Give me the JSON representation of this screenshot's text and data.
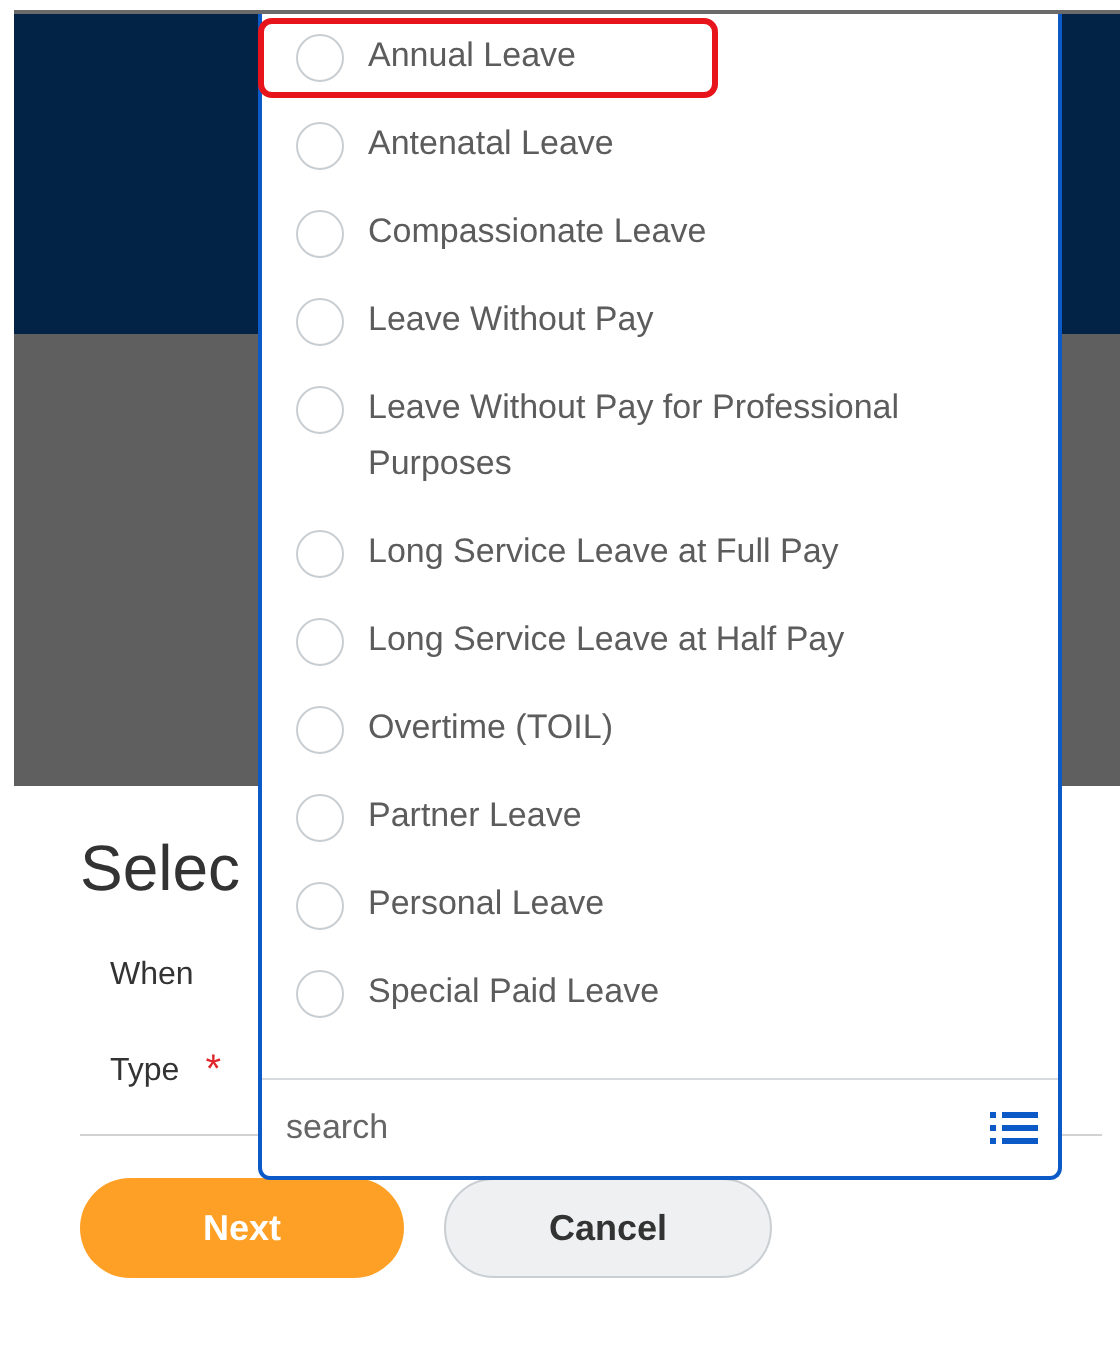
{
  "page": {
    "heading": "Selec"
  },
  "form": {
    "fields": [
      {
        "label": "When"
      },
      {
        "label": "Type",
        "required_mark": "*"
      }
    ]
  },
  "dropdown": {
    "options": [
      {
        "label": "Annual Leave",
        "selected": false,
        "highlighted": true
      },
      {
        "label": "Antenatal Leave",
        "selected": false,
        "highlighted": false
      },
      {
        "label": "Compassionate Leave",
        "selected": false,
        "highlighted": false
      },
      {
        "label": "Leave Without Pay",
        "selected": false,
        "highlighted": false
      },
      {
        "label": "Leave Without Pay for Professional Purposes",
        "selected": false,
        "highlighted": false
      },
      {
        "label": "Long Service Leave at Full Pay",
        "selected": false,
        "highlighted": false
      },
      {
        "label": "Long Service Leave at Half Pay",
        "selected": false,
        "highlighted": false
      },
      {
        "label": "Overtime (TOIL)",
        "selected": false,
        "highlighted": false
      },
      {
        "label": "Partner Leave",
        "selected": false,
        "highlighted": false
      },
      {
        "label": "Personal Leave",
        "selected": false,
        "highlighted": false
      },
      {
        "label": "Special Paid Leave",
        "selected": false,
        "highlighted": false
      }
    ],
    "search": {
      "placeholder": "search"
    }
  },
  "buttons": [
    {
      "label": "Next",
      "kind": "primary"
    },
    {
      "label": "Cancel",
      "kind": "secondary"
    }
  ]
}
